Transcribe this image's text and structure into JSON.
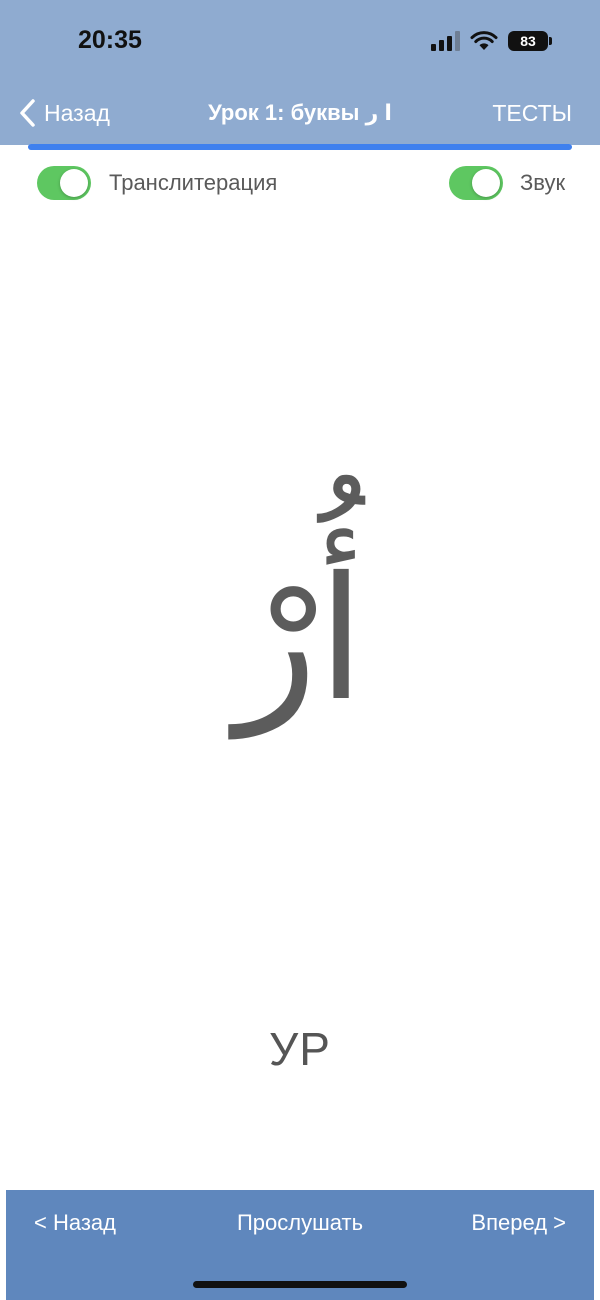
{
  "status_bar": {
    "time": "20:35",
    "battery": "83",
    "icons": [
      "signal-icon",
      "wifi-icon",
      "battery-icon"
    ]
  },
  "nav": {
    "back_label": "Назад",
    "title": "Урок 1: буквы ا ر",
    "tests_label": "ТЕСТЫ"
  },
  "progress": {
    "value_percent": 100
  },
  "toggles": {
    "transliteration": {
      "label": "Транслитерация",
      "on": true
    },
    "sound": {
      "label": "Звук",
      "on": true
    }
  },
  "card": {
    "arabic": "أُرْ",
    "transliteration": "УР"
  },
  "bottom_bar": {
    "prev_label": "< Назад",
    "listen_label": "Прослушать",
    "next_label": "Вперед >"
  },
  "colors": {
    "header_bg": "#8fabd0",
    "progress": "#3f80ee",
    "toggle_on": "#5ec761",
    "bottom_bg": "#5f87bd"
  }
}
